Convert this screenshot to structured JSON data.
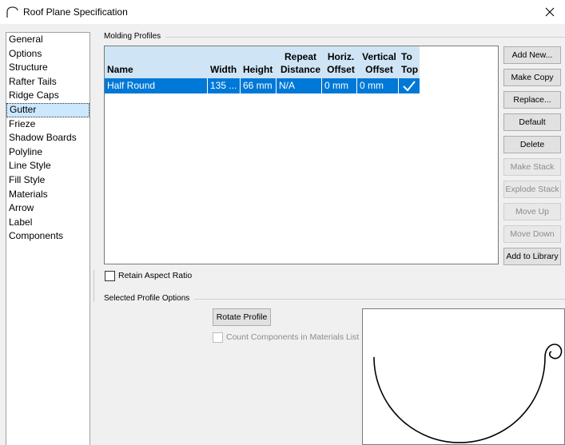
{
  "window": {
    "title": "Roof Plane Specification",
    "icon": "roof-icon",
    "close_icon": "close-icon"
  },
  "sidebar": {
    "items": [
      {
        "label": "General",
        "selected": false
      },
      {
        "label": "Options",
        "selected": false
      },
      {
        "label": "Structure",
        "selected": false
      },
      {
        "label": "Rafter Tails",
        "selected": false
      },
      {
        "label": "Ridge Caps",
        "selected": false
      },
      {
        "label": "Gutter",
        "selected": true
      },
      {
        "label": "Frieze",
        "selected": false
      },
      {
        "label": "Shadow Boards",
        "selected": false
      },
      {
        "label": "Polyline",
        "selected": false
      },
      {
        "label": "Line Style",
        "selected": false
      },
      {
        "label": "Fill Style",
        "selected": false
      },
      {
        "label": "Materials",
        "selected": false
      },
      {
        "label": "Arrow",
        "selected": false
      },
      {
        "label": "Label",
        "selected": false
      },
      {
        "label": "Components",
        "selected": false
      }
    ]
  },
  "molding_profiles": {
    "group_label": "Molding Profiles",
    "columns": [
      {
        "line1": "",
        "line2": "Name"
      },
      {
        "line1": "",
        "line2": "Width"
      },
      {
        "line1": "",
        "line2": "Height"
      },
      {
        "line1": "Repeat",
        "line2": "Distance"
      },
      {
        "line1": "Horiz.",
        "line2": "Offset"
      },
      {
        "line1": "Vertical",
        "line2": "Offset"
      },
      {
        "line1": "To",
        "line2": "Top"
      }
    ],
    "rows": [
      {
        "name": "Half Round",
        "width": "135 ...",
        "height": "66 mm",
        "repeat_distance": "N/A",
        "horiz_offset": "0 mm",
        "vertical_offset": "0 mm",
        "to_top": "check-icon"
      }
    ]
  },
  "buttons": {
    "add_new": "Add New...",
    "make_copy": "Make Copy",
    "replace": "Replace...",
    "default": "Default",
    "delete": "Delete",
    "make_stack": "Make Stack",
    "explode_stack": "Explode Stack",
    "move_up": "Move Up",
    "move_down": "Move Down",
    "add_to_library": "Add to Library"
  },
  "retain_aspect_ratio": {
    "label": "Retain Aspect Ratio",
    "checked": false
  },
  "selected_profile_options": {
    "group_label": "Selected Profile Options",
    "rotate_button": "Rotate Profile",
    "count_components": {
      "label": "Count Components in Materials List",
      "checked": false,
      "enabled": false
    }
  },
  "colors": {
    "selection": "#0078d7",
    "header": "#cfe5f5",
    "sidebar_selected": "#cce8ff"
  }
}
